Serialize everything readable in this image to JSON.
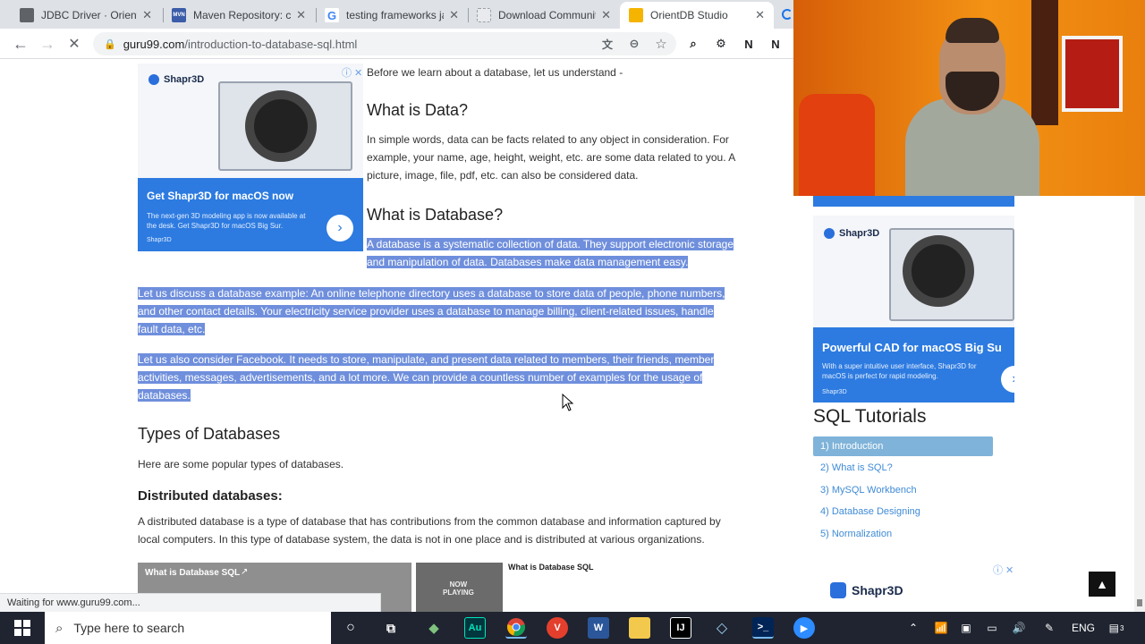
{
  "tabs": [
    {
      "label": "JDBC Driver · OrientDB",
      "favicon": "document-icon",
      "fav_color": "#3c4043"
    },
    {
      "label": "Maven Repository: com",
      "favicon": "mvn-icon",
      "fav_color": "#3b5ca8",
      "fav_text": "MVN"
    },
    {
      "label": "testing frameworks ja",
      "favicon": "google-icon",
      "fav_color": "#4285f4",
      "fav_text": "G"
    },
    {
      "label": "Download Community",
      "favicon": "page-icon",
      "fav_color": "#9aa0a6"
    },
    {
      "label": "OrientDB Studio",
      "favicon": "orientdb-icon",
      "fav_color": "#f4b400"
    }
  ],
  "address": {
    "host": "guru99.com",
    "path": "/introduction-to-database-sql.html"
  },
  "article": {
    "intro": "Before we learn about a database, let us understand -",
    "h_data": "What is Data?",
    "p_data": [
      "In simple words, data can be facts related to any object in consideration. For",
      "example, your name, age, height, weight, etc. are some data related to you. A",
      "picture, image, file, pdf, etc. can also be considered data."
    ],
    "h_db": "What is Database?",
    "p_db": [
      "A database is a systematic collection of data. They support electronic storage",
      "and manipulation of data. Databases make data management easy."
    ],
    "p_example": [
      "Let us discuss a database example: An online telephone directory uses a database to store data of people, phone numbers,",
      "and other contact details. Your electricity service provider uses a database to manage billing, client-related issues, handle",
      "fault data, etc."
    ],
    "p_facebook": [
      "Let us also consider Facebook. It needs to store, manipulate, and present data related to members, their friends, member",
      "activities, messages, advertisements, and a lot more. We can provide a countless number of examples for the usage of",
      "databases."
    ],
    "h_types": "Types of Databases",
    "p_types": "Here are some popular types of databases.",
    "h_distributed": "Distributed databases:",
    "p_distributed": [
      "A distributed database is a type of database that has contributions from the common database and information captured by",
      "local computers. In this type of database system, the data is not in one place and is distributed at various organizations."
    ],
    "video_title": "What is Database SQL",
    "video_side_title": "What is Database SQL",
    "now_playing": "NOW\nPLAYING"
  },
  "ad1": {
    "brand": "Shapr3D",
    "headline": "Get Shapr3D for macOS now",
    "sub": "The next-gen 3D modeling app is now available at the desk. Get Shapr3D for macOS Big Sur.",
    "foot": "Shapr3D"
  },
  "ad2": {
    "brand": "Shapr3D",
    "headline": "Powerful CAD for macOS Big Su",
    "sub": "With a super intuitive user interface, Shapr3D for macOS is perfect for rapid modeling.",
    "foot": "Shapr3D"
  },
  "ad3": {
    "brand": "Shapr3D"
  },
  "sidebar": {
    "title": "SQL Tutorials",
    "items": [
      {
        "label": "1) Introduction",
        "active": true
      },
      {
        "label": "2) What is SQL?",
        "active": false
      },
      {
        "label": "3) MySQL Workbench",
        "active": false
      },
      {
        "label": "4) Database Designing",
        "active": false
      },
      {
        "label": "5) Normalization",
        "active": false
      }
    ]
  },
  "status_text": "Waiting for www.guru99.com...",
  "taskbar": {
    "search_placeholder": "Type here to search",
    "language": "ENG",
    "notification_count": "3"
  }
}
